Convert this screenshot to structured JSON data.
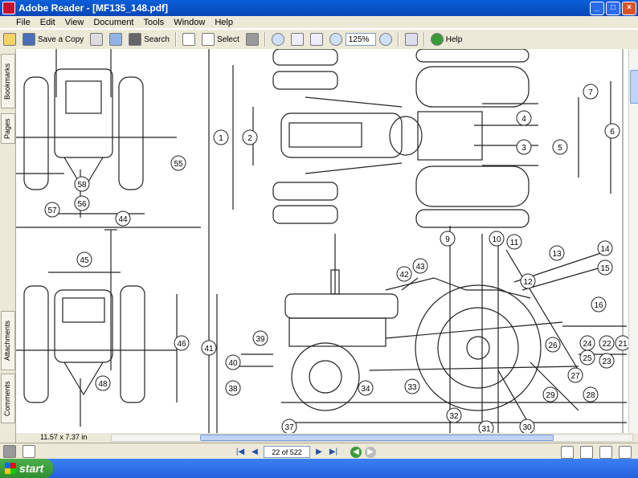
{
  "window": {
    "title": "Adobe Reader - [MF135_148.pdf]",
    "min": "_",
    "max": "□",
    "close": "×"
  },
  "menu": [
    "File",
    "Edit",
    "View",
    "Document",
    "Tools",
    "Window",
    "Help"
  ],
  "toolbar": {
    "save_copy": "Save a Copy",
    "search": "Search",
    "select": "Select",
    "zoom": "125%",
    "help": "Help"
  },
  "status": {
    "page_size": "11.57 x 7.37 in"
  },
  "nav": {
    "page": "22 of 522"
  },
  "taskbar": {
    "start": "start"
  },
  "left_tabs": {
    "bookmarks": "Bookmarks",
    "pages": "Pages",
    "attachments": "Attachments",
    "comments": "Comments"
  },
  "drawing": {
    "labels": [
      "1",
      "2",
      "3",
      "4",
      "5",
      "6",
      "7",
      "9",
      "10",
      "11",
      "12",
      "13",
      "14",
      "15",
      "16",
      "21",
      "22",
      "23",
      "24",
      "25",
      "26",
      "27",
      "28",
      "29",
      "30",
      "31",
      "32",
      "33",
      "34",
      "37",
      "38",
      "39",
      "40",
      "41",
      "42",
      "43",
      "44",
      "45",
      "46",
      "48",
      "55",
      "56",
      "57",
      "58"
    ]
  }
}
